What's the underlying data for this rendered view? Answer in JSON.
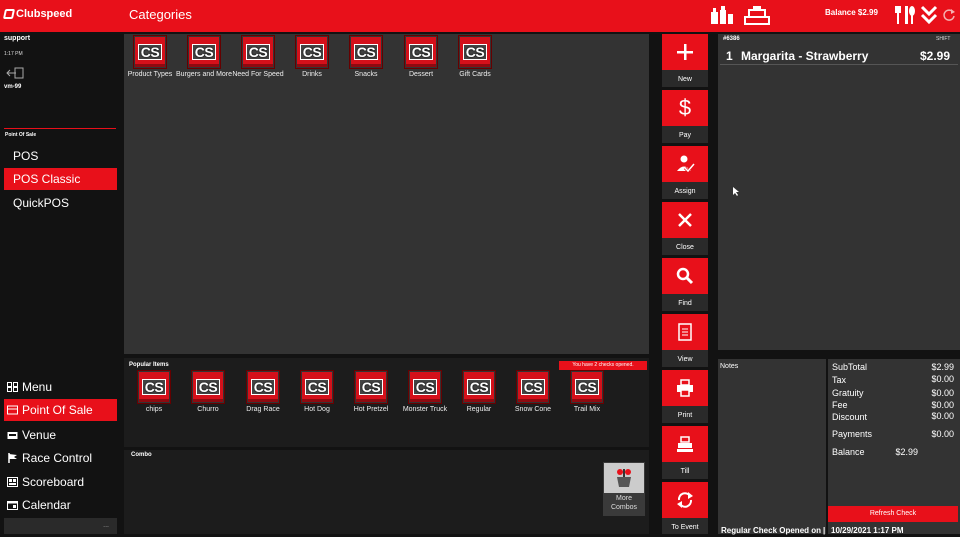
{
  "header": {
    "logo_text": "Clubspeed",
    "title": "Categories",
    "balance": "Balance $2.99",
    "icons": [
      "condiments-icon",
      "register-icon",
      "dining-icon",
      "chevrons-down-icon",
      "refresh-icon"
    ]
  },
  "session": {
    "user": "support",
    "time": "1:17 PM",
    "terminal": "vm-99",
    "section": "Point Of Sale"
  },
  "pos_modes": [
    {
      "label": "POS",
      "active": false
    },
    {
      "label": "POS Classic",
      "active": true
    },
    {
      "label": "QuickPOS",
      "active": false
    }
  ],
  "nav": [
    {
      "label": "Menu",
      "icon": "grid-icon",
      "active": false
    },
    {
      "label": "Point Of Sale",
      "icon": "pos-icon",
      "active": true
    },
    {
      "label": "Venue",
      "icon": "venue-icon",
      "active": false
    },
    {
      "label": "Race Control",
      "icon": "flag-icon",
      "active": false
    },
    {
      "label": "Scoreboard",
      "icon": "scoreboard-icon",
      "active": false
    },
    {
      "label": "Calendar",
      "icon": "calendar-icon",
      "active": false
    }
  ],
  "sidebar_more": "...",
  "tile_icon_text": "CS",
  "categories": [
    {
      "label": "Product Types"
    },
    {
      "label": "Burgers and More"
    },
    {
      "label": "Need For Speed"
    },
    {
      "label": "Drinks"
    },
    {
      "label": "Snacks"
    },
    {
      "label": "Dessert"
    },
    {
      "label": "Gift Cards"
    }
  ],
  "popular": {
    "title": "Popular Items",
    "badge": "You have 2 checks opened.",
    "items": [
      {
        "label": "chips"
      },
      {
        "label": "Churro"
      },
      {
        "label": "Drag Race"
      },
      {
        "label": "Hot Dog"
      },
      {
        "label": "Hot Pretzel"
      },
      {
        "label": "Monster Truck"
      },
      {
        "label": "Regular"
      },
      {
        "label": "Snow Cone"
      },
      {
        "label": "Trail Mix"
      }
    ]
  },
  "combo": {
    "title": "Combo",
    "more_label_1": "More",
    "more_label_2": "Combos"
  },
  "actions": [
    {
      "label": "New",
      "icon": "plus-icon"
    },
    {
      "label": "Pay",
      "icon": "dollar-icon"
    },
    {
      "label": "Assign",
      "icon": "assign-user-icon"
    },
    {
      "label": "Close",
      "icon": "close-icon"
    },
    {
      "label": "Find",
      "icon": "search-icon"
    },
    {
      "label": "View",
      "icon": "document-icon"
    },
    {
      "label": "Print",
      "icon": "printer-icon"
    },
    {
      "label": "Till",
      "icon": "till-icon"
    },
    {
      "label": "To Event",
      "icon": "transfer-icon"
    }
  ],
  "check": {
    "number": "#6386",
    "shift": "SHIFT",
    "lines": [
      {
        "qty": "1",
        "name": "Margarita - Strawberry",
        "price": "$2.99"
      }
    ],
    "notes_title": "Notes",
    "totals": {
      "subtotal_label": "SubTotal",
      "subtotal": "$2.99",
      "tax_label": "Tax",
      "tax": "$0.00",
      "gratuity_label": "Gratuity",
      "gratuity": "$0.00",
      "fee_label": "Fee",
      "fee": "$0.00",
      "discount_label": "Discount",
      "discount": "$0.00",
      "payments_label": "Payments",
      "payments": "$0.00",
      "balance_label": "Balance",
      "balance": "$2.99"
    },
    "refresh_label": "Refresh Check",
    "footer_left": "Regular Check Opened on",
    "footer_sep": "|",
    "footer_date": "10/29/2021 1:17 PM"
  },
  "colors": {
    "accent": "#e8101a",
    "panel": "#333333",
    "background": "#121212"
  }
}
